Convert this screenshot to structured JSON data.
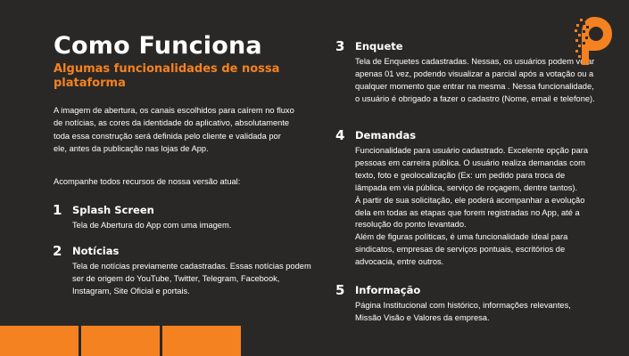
{
  "header": {
    "title": "Como Funciona",
    "subtitle": "Algumas funcionalidades de nossa plataforma"
  },
  "intro": {
    "paragraph": "A imagem de abertura, os canais escolhidos para caírem no fluxo de notícias, as cores da identidade do aplicativo, absolutamente toda essa construção será definida pelo cliente e validada por ele, antes da publicação nas lojas de App.",
    "follow_up": "Acompanhe todos recursos de nossa versão atual:"
  },
  "features": [
    {
      "number": "1",
      "name": "Splash Screen",
      "description": "Tela de Abertura do App com uma imagem."
    },
    {
      "number": "2",
      "name": "Notícias",
      "description": "Tela de notícias previamente cadastradas. Essas notícias podem ser de origem do YouTube, Twitter, Telegram, Facebook, Instagram, Site Oficial e portais."
    },
    {
      "number": "3",
      "name": "Enquete",
      "description": "Tela de Enquetes cadastradas. Nessas, os usuários podem votar apenas 01 vez, podendo visualizar a parcial após a votação ou a qualquer momento que entrar na mesma . Nessa funcionalidade, o usuário é obrigado a fazer o cadastro (Nome, email e telefone)."
    },
    {
      "number": "4",
      "name": "Demandas",
      "description_1": "Funcionalidade para usuário cadastrado. Excelente opção para pessoas em carreira pública. O usuário realiza demandas com texto, foto e geolocalização (Ex: um pedido para troca de lâmpada em via pública, serviço de roçagem, dentre tantos).",
      "description_2": "À partir de sua solicitação, ele poderá acompanhar a evolução dela em todas as etapas que forem registradas no App, até a resolução do ponto levantado.",
      "description_3": "Além de figuras políticas, é uma funcionalidade ideal para sindicatos, empresas de serviços pontuais, escritórios de advocacia, entre outros."
    },
    {
      "number": "5",
      "name": "Informação",
      "description": "Página Institucional com histórico, informações relevantes, Missão Visão e Valores da empresa."
    }
  ],
  "colors": {
    "accent": "#f58220",
    "background": "#2a2826",
    "text": "#ffffff"
  },
  "icons": {
    "logo": "pixel-p-logo-icon"
  }
}
